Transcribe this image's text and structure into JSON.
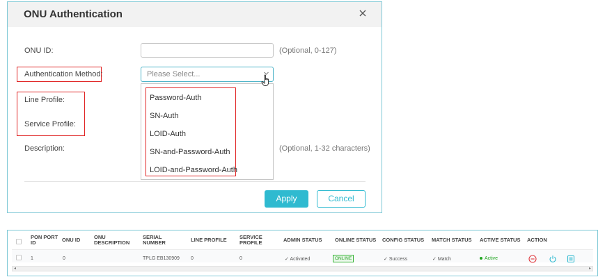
{
  "dialog": {
    "title": "ONU Authentication",
    "labels": {
      "onu_id": "ONU ID:",
      "auth_method": "Authentication Method:",
      "line_profile": "Line Profile:",
      "service_profile": "Service Profile:",
      "description": "Description:"
    },
    "hints": {
      "onu_id": "(Optional, 0-127)",
      "description": "(Optional, 1-32 characters)"
    },
    "onu_id_value": "",
    "select_placeholder": "Please Select...",
    "options": [
      "Password-Auth",
      "SN-Auth",
      "LOID-Auth",
      "SN-and-Password-Auth",
      "LOID-and-Password-Auth"
    ],
    "apply_label": "Apply",
    "cancel_label": "Cancel"
  },
  "table": {
    "headers": {
      "pon_port_id": "PON PORT ID",
      "onu_id": "ONU ID",
      "onu_description": "ONU DESCRIPTION",
      "serial_number": "SERIAL NUMBER",
      "line_profile": "LINE PROFILE",
      "service_profile": "SERVICE PROFILE",
      "admin_status": "ADMIN STATUS",
      "online_status": "ONLINE STATUS",
      "config_status": "CONFIG STATUS",
      "match_status": "MATCH STATUS",
      "active_status": "ACTIVE STATUS",
      "action": "ACTION"
    },
    "row": {
      "pon_port_id": "1",
      "onu_id": "0",
      "onu_description": "",
      "serial_number": "TPLG EB130909",
      "line_profile": "0",
      "service_profile": "0",
      "admin_status": "Activated",
      "online_status": "ONLINE",
      "config_status": "Success",
      "match_status": "Match",
      "active_status": "Active"
    }
  },
  "colors": {
    "accent": "#2fbad0",
    "highlight": "#e02424",
    "online": "#22a022",
    "action_red": "#e0383e"
  }
}
